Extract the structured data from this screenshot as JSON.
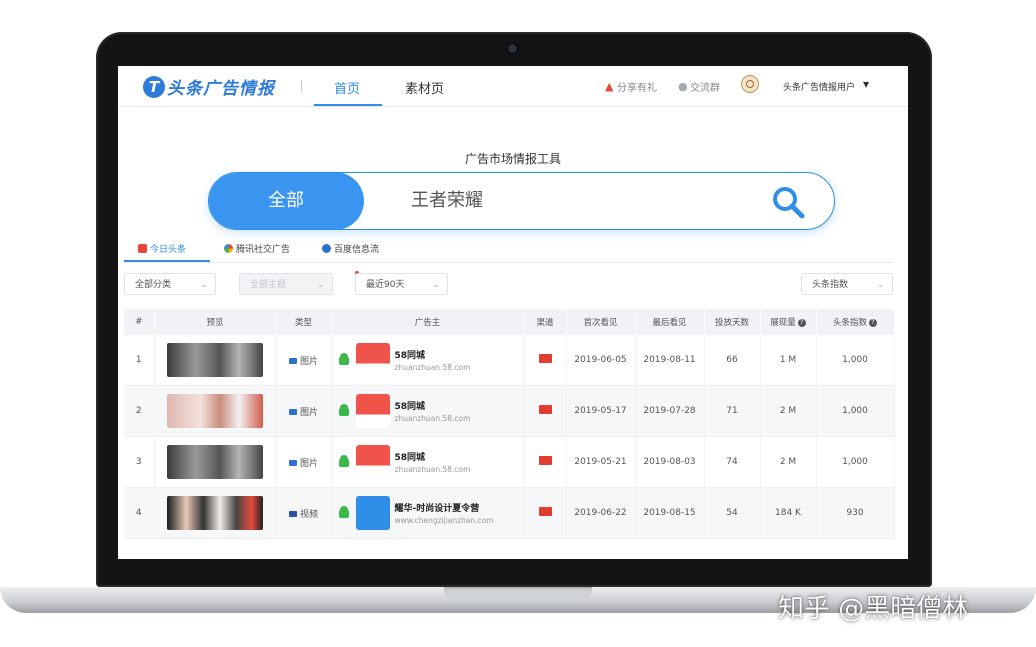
{
  "header": {
    "logo_text": "头条广告情报",
    "nav": [
      {
        "label": "首页",
        "active": true
      },
      {
        "label": "素材页",
        "active": false
      }
    ],
    "share_label": "分享有礼",
    "group_label": "交流群",
    "user_name": "头条广告情报用户"
  },
  "hero": {
    "title": "广告市场情报工具",
    "category": "全部",
    "query": "王者荣耀"
  },
  "tabs": [
    {
      "label": "今日头条",
      "active": true,
      "icon": "toutiao-icon",
      "color": "#e8453c"
    },
    {
      "label": "腾讯社交广告",
      "active": false,
      "icon": "tencent-icon",
      "color": "#2f8ee8"
    },
    {
      "label": "百度信息流",
      "active": false,
      "icon": "baidu-icon",
      "color": "#2f6fd0"
    }
  ],
  "filters": {
    "category": "全部分类",
    "theme": "全部主题",
    "period": "最近90天",
    "sort": "头条指数"
  },
  "table": {
    "columns": [
      "#",
      "预览",
      "类型",
      "广告主",
      "渠道",
      "首次看见",
      "最后看见",
      "投放天数",
      "展现量",
      "头条指数"
    ],
    "rows": [
      {
        "idx": "1",
        "type": "图片",
        "adv_name": "58同城",
        "adv_url": "zhuanzhuan.58.com",
        "first": "2019-06-05",
        "last": "2019-08-11",
        "days": "66",
        "views": "1 M",
        "score": "1,000"
      },
      {
        "idx": "2",
        "type": "图片",
        "adv_name": "58同城",
        "adv_url": "zhuanzhuan.58.com",
        "first": "2019-05-17",
        "last": "2019-07-28",
        "days": "71",
        "views": "2 M",
        "score": "1,000"
      },
      {
        "idx": "3",
        "type": "图片",
        "adv_name": "58同城",
        "adv_url": "zhuanzhuan.58.com",
        "first": "2019-05-21",
        "last": "2019-08-03",
        "days": "74",
        "views": "2 M",
        "score": "1,000"
      },
      {
        "idx": "4",
        "type": "视频",
        "adv_name": "耀华-时尚设计夏令营",
        "adv_url": "www.chengzijianzhan.com",
        "first": "2019-06-22",
        "last": "2019-08-15",
        "days": "54",
        "views": "184 K",
        "score": "930"
      }
    ]
  },
  "watermark": "知乎 @黑暗僧林",
  "colors": {
    "accent": "#2f8ee8",
    "search_fill": "#3a95f0",
    "brand_red": "#e8453c"
  }
}
